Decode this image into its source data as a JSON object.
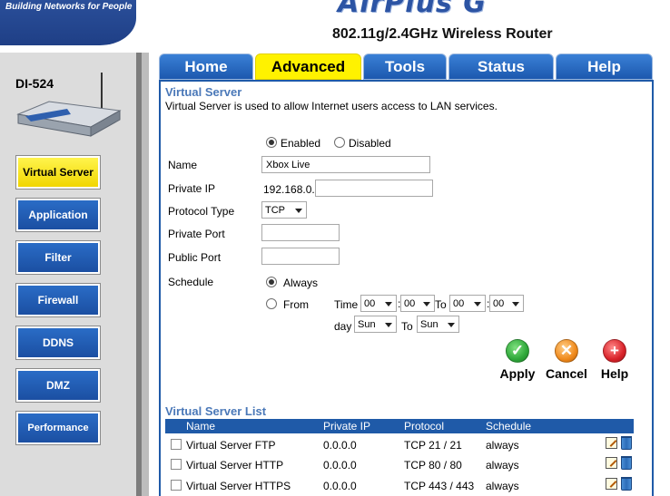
{
  "header": {
    "tagline": "Building Networks for People",
    "brand": "AirPlus G",
    "product": "802.11g/2.4GHz Wireless Router"
  },
  "device": {
    "model": "DI-524"
  },
  "sidebar": {
    "items": [
      {
        "label": "Virtual Server",
        "active": true
      },
      {
        "label": "Application",
        "active": false
      },
      {
        "label": "Filter",
        "active": false
      },
      {
        "label": "Firewall",
        "active": false
      },
      {
        "label": "DDNS",
        "active": false
      },
      {
        "label": "DMZ",
        "active": false
      },
      {
        "label": "Performance",
        "active": false
      }
    ]
  },
  "tabs": [
    {
      "label": "Home",
      "active": false
    },
    {
      "label": "Advanced",
      "active": true
    },
    {
      "label": "Tools",
      "active": false
    },
    {
      "label": "Status",
      "active": false
    },
    {
      "label": "Help",
      "active": false
    }
  ],
  "form": {
    "title": "Virtual Server",
    "description": "Virtual Server is used to allow Internet users access to LAN services.",
    "enabled_label": "Enabled",
    "disabled_label": "Disabled",
    "enabled": true,
    "name_label": "Name",
    "name_value": "Xbox Live",
    "private_ip_label": "Private IP",
    "private_ip_prefix": "192.168.0.",
    "private_ip_value": "",
    "protocol_label": "Protocol Type",
    "protocol_value": "TCP",
    "private_port_label": "Private Port",
    "private_port_value": "",
    "public_port_label": "Public Port",
    "public_port_value": "",
    "schedule_label": "Schedule",
    "always_label": "Always",
    "from_label": "From",
    "schedule_always": true,
    "time_label": "Time",
    "to_label": "To",
    "time_from_hour": "00",
    "time_from_min": "00",
    "time_to_hour": "00",
    "time_to_min": "00",
    "day_label": "day",
    "day_from": "Sun",
    "day_to": "Sun"
  },
  "actions": {
    "apply": "Apply",
    "cancel": "Cancel",
    "help": "Help"
  },
  "list": {
    "title": "Virtual Server List",
    "columns": [
      "Name",
      "Private IP",
      "Protocol",
      "Schedule"
    ],
    "rows": [
      {
        "name": "Virtual Server FTP",
        "ip": "0.0.0.0",
        "protocol": "TCP 21 / 21",
        "schedule": "always"
      },
      {
        "name": "Virtual Server HTTP",
        "ip": "0.0.0.0",
        "protocol": "TCP 80 / 80",
        "schedule": "always"
      },
      {
        "name": "Virtual Server HTTPS",
        "ip": "0.0.0.0",
        "protocol": "TCP 443 / 443",
        "schedule": "always"
      }
    ]
  },
  "colors": {
    "nav_blue": "#1f5aa8",
    "active_yellow": "#fff200",
    "section_title": "#4a78b8",
    "apply_green": "#2fa83a",
    "cancel_orange": "#f08a1c",
    "help_red": "#d9232a"
  }
}
